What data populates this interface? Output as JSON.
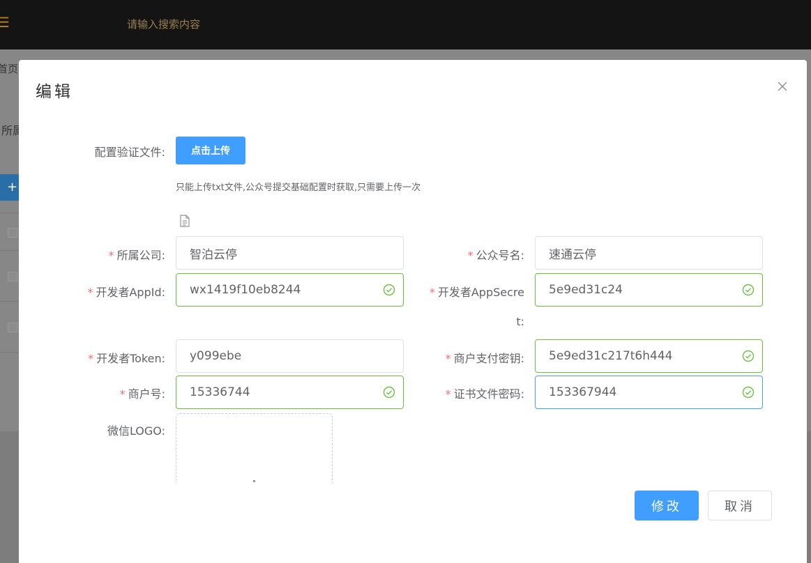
{
  "header": {
    "search_placeholder": "请输入搜索内容",
    "menu_icon": "menu-icon"
  },
  "background": {
    "tab_label": "首页",
    "field_label": "所属",
    "add_symbol": "+"
  },
  "dialog": {
    "title": "编辑",
    "close_icon": "close-icon",
    "verify_file": {
      "label": "配置验证文件:",
      "button": "点击上传",
      "hint": "只能上传txt文件,公众号提交基础配置时获取,只需要上传一次"
    },
    "fields": {
      "company": {
        "label": "所属公司:",
        "value": "智泊云停",
        "required": true
      },
      "account_name": {
        "label": "公众号名:",
        "value": "速通云停",
        "required": true
      },
      "app_id": {
        "label": "开发者AppId:",
        "value": "wx1419f10eb8244",
        "required": true
      },
      "app_secret": {
        "label_line1": "开发者AppSecre",
        "label_line2": "t:",
        "value": "5e9ed31c24",
        "required": true
      },
      "token": {
        "label": "开发者Token:",
        "value": "y099ebe",
        "required": true
      },
      "pay_key": {
        "label": "商户支付密钥:",
        "value": "5e9ed31c217t6h444",
        "required": true
      },
      "merchant_no": {
        "label": "商户号:",
        "value": "15336744",
        "required": true
      },
      "cert_password": {
        "label": "证书文件密码:",
        "value": "153367944",
        "required": true
      },
      "logo": {
        "label": "微信LOGO:"
      }
    },
    "required_mark": "*",
    "footer": {
      "confirm": "修改",
      "cancel": "取消"
    }
  },
  "colors": {
    "primary": "#409eff",
    "success": "#67c23a",
    "required": "#f56c6c",
    "topbar": "#141414"
  }
}
